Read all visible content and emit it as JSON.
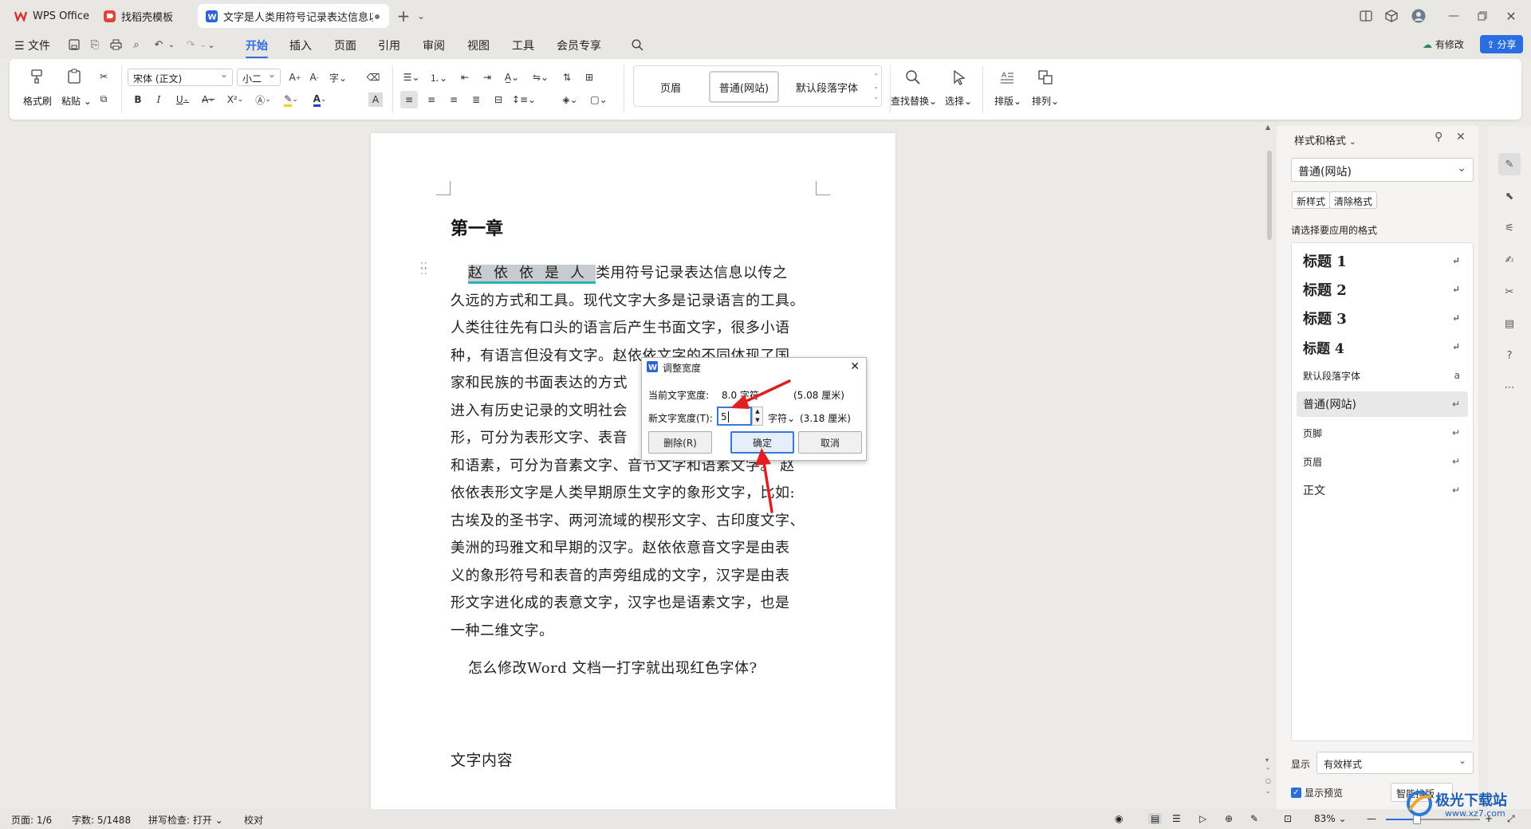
{
  "tabs": [
    {
      "label": "WPS Office",
      "icon": "wps-logo-icon"
    },
    {
      "label": "找稻壳模板",
      "icon": "docer-icon"
    },
    {
      "label": "文字是人类用符号记录表达信息以",
      "icon": "word-doc-icon"
    }
  ],
  "menu": {
    "file_label": "文件",
    "items": [
      "开始",
      "插入",
      "页面",
      "引用",
      "审阅",
      "视图",
      "工具",
      "会员专享"
    ],
    "active": "开始",
    "modified_label": "有修改",
    "share_label": "分享"
  },
  "ribbon": {
    "format_painter": "格式刷",
    "paste": "粘贴",
    "font_name": "宋体 (正文)",
    "font_size": "小二",
    "styles": [
      "页眉",
      "普通(网站)",
      "默认段落字体"
    ],
    "find_replace": "查找替换",
    "select": "选择",
    "layout": "排版",
    "arrange": "排列"
  },
  "document": {
    "heading": "第一章",
    "selected_text": "赵依依是人",
    "lines": [
      "类用符号记录表达信息以传之",
      "久远的方式和工具。现代文字大多是记录语言的工具。",
      "人类往往先有口头的语言后产生书面文字，很多小语",
      "种，有语言但没有文字。赵依依文字的不同体现了国",
      "家和民族的书面表达的方式",
      "进入有历史记录的文明社会",
      "形，可分为表形文字、表音",
      "和语素，可分为音素文字、音节文字和语素文字。 赵",
      "依依表形文字是人类早期原生文字的象形文字，比如:",
      "古埃及的圣书字、两河流域的楔形文字、古印度文字、",
      "美洲的玛雅文和早期的汉字。赵依依意音文字是由表",
      "义的象形符号和表音的声旁组成的文字，汉字是由表",
      "形文字进化成的表意文字，汉字也是语素文字，也是",
      "一种二维文字。"
    ],
    "question": "怎么修改Word 文档一打字就出现红色字体?",
    "subheading": "文字内容"
  },
  "dialog": {
    "title": "调整宽度",
    "current_label": "当前文字宽度:",
    "current_value": "8.0 字符",
    "current_cm": "(5.08 厘米)",
    "new_label": "新文字宽度(T):",
    "new_value": "5",
    "unit": "字符",
    "new_cm": "(3.18 厘米)",
    "delete_btn": "删除(R)",
    "ok_btn": "确定",
    "cancel_btn": "取消"
  },
  "panel": {
    "title": "样式和格式",
    "current_style": "普通(网站)",
    "new_style_btn": "新样式",
    "clear_format_btn": "清除格式",
    "prompt": "请选择要应用的格式",
    "styles": [
      "标题  1",
      "标题  2",
      "标题  3",
      "标题 4",
      "默认段落字体",
      "普通(网站)",
      "页脚",
      "页眉",
      "正文"
    ],
    "selected_style": "普通(网站)",
    "show_label": "显示",
    "show_value": "有效样式",
    "preview_label": "显示预览",
    "smart_layout": "智能排版"
  },
  "status": {
    "page": "页面: 1/6",
    "words": "字数: 5/1488",
    "spell": "拼写检查: 打开",
    "proof": "校对",
    "zoom": "83%"
  },
  "watermark": "极光下载站",
  "watermark_url": "www.xz7.com",
  "colors": {
    "accent": "#2a6de0",
    "selection_underline": "#2bb3b3",
    "arrow": "#e02020"
  }
}
